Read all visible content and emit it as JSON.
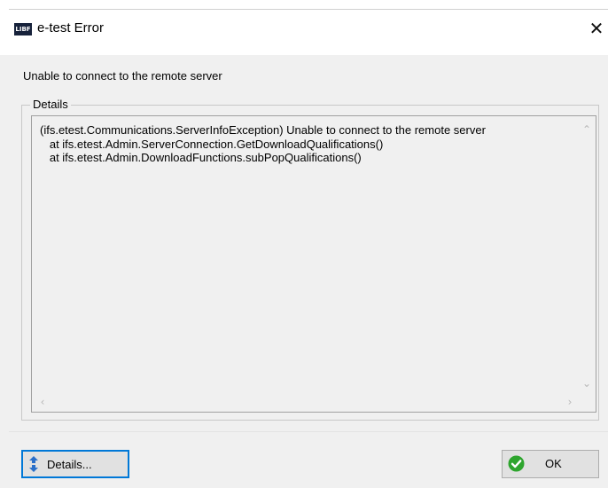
{
  "window": {
    "app_icon_text": "LIBF",
    "title": "e-test Error",
    "close_glyph": "✕"
  },
  "message": "Unable to connect to the remote server",
  "details_group": {
    "label": "Details",
    "lines": [
      "(ifs.etest.Communications.ServerInfoException) Unable to connect to the remote server",
      "   at ifs.etest.Admin.ServerConnection.GetDownloadQualifications()",
      "   at ifs.etest.Admin.DownloadFunctions.subPopQualifications()"
    ]
  },
  "buttons": {
    "details_label": "Details...",
    "ok_label": "OK"
  },
  "icons": {
    "details_button_icon": "up-down-arrows-icon",
    "ok_button_icon": "green-check-icon"
  },
  "colors": {
    "focus_border": "#0078d7",
    "app_icon_bg": "#17223b",
    "check_green": "#2ea52e",
    "arrow_blue": "#2a6fc9"
  }
}
